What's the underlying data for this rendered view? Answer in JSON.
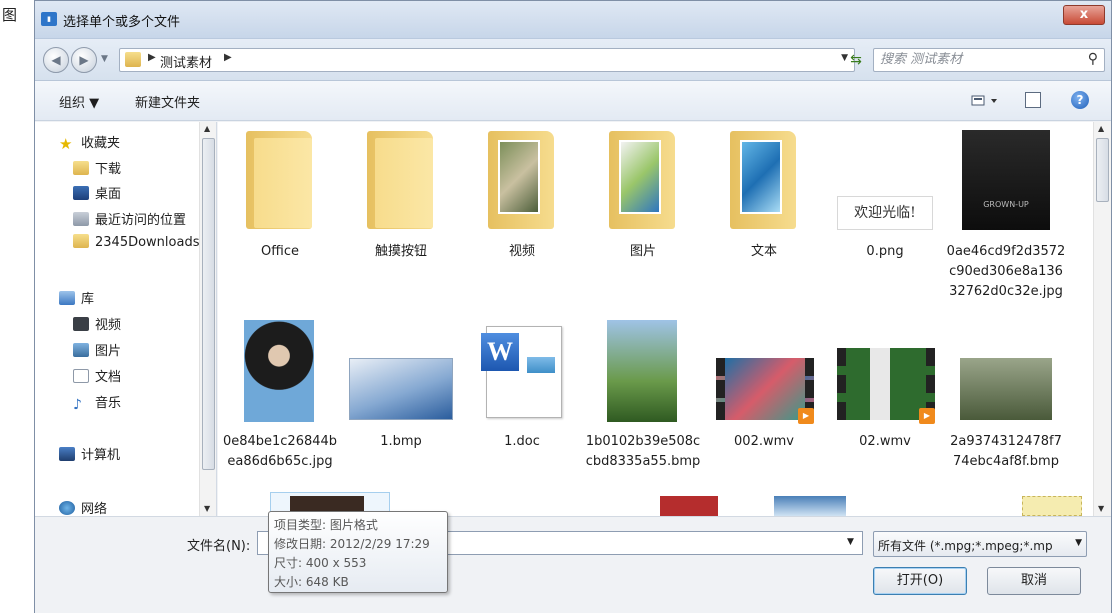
{
  "background_app": {
    "partial_char": "图"
  },
  "dialog": {
    "title": "选择单个或多个文件",
    "close_label": "x",
    "address": {
      "breadcrumb": "测试素材"
    },
    "search": {
      "placeholder": "搜索 测试素材"
    },
    "toolbar": {
      "organize": "组织 ▼",
      "new_folder": "新建文件夹"
    },
    "nav": {
      "favorites": {
        "label": "收藏夹",
        "items": [
          "下载",
          "桌面",
          "最近访问的位置",
          "2345Downloads"
        ]
      },
      "libraries": {
        "label": "库",
        "items": [
          "视频",
          "图片",
          "文档",
          "音乐"
        ]
      },
      "computer": "计算机",
      "network": "网络"
    },
    "files": [
      {
        "name": "Office",
        "kind": "folder"
      },
      {
        "name": "触摸按钮",
        "kind": "folder"
      },
      {
        "name": "视频",
        "kind": "folder-image"
      },
      {
        "name": "图片",
        "kind": "folder-image"
      },
      {
        "name": "文本",
        "kind": "folder-image"
      },
      {
        "name": "0.png",
        "kind": "image",
        "image_text": "欢迎光临!"
      },
      {
        "name": "0ae46cd9f2d3572c90ed306e8a13632762d0c32e.jpg",
        "kind": "photo",
        "image_text": "GROWN-UP"
      },
      {
        "name": "0e84be1c26844bea86d6b65c.jpg",
        "kind": "photo"
      },
      {
        "name": "1.bmp",
        "kind": "photo"
      },
      {
        "name": "1.doc",
        "kind": "doc"
      },
      {
        "name": "1b0102b39e508ccbd8335a55.bmp",
        "kind": "photo"
      },
      {
        "name": "002.wmv",
        "kind": "video"
      },
      {
        "name": "02.wmv",
        "kind": "video"
      },
      {
        "name": "2a9374312478f774ebc4af8f.bmp",
        "kind": "photo"
      }
    ],
    "filename": {
      "label": "文件名(N):",
      "value": ""
    },
    "filetype": {
      "selected": "所有文件 (*.mpg;*.mpeg;*.mp"
    },
    "buttons": {
      "open": "打开(O)",
      "cancel": "取消"
    },
    "tooltip": {
      "type": "项目类型: 图片格式",
      "modified": "修改日期: 2012/2/29 17:29",
      "dimensions": "尺寸: 400 x 553",
      "size": "大小: 648 KB"
    }
  }
}
